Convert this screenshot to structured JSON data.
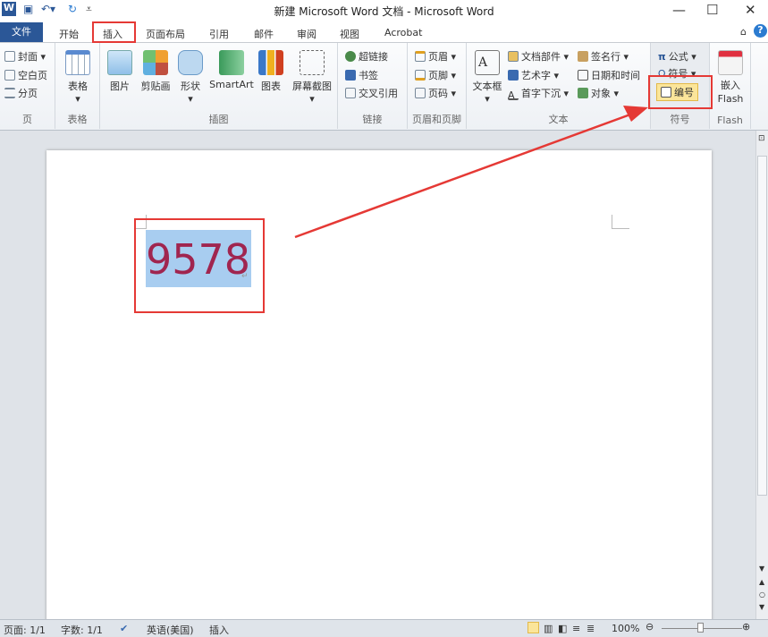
{
  "window": {
    "title": "新建 Microsoft Word 文档 - Microsoft Word"
  },
  "tabs": [
    {
      "label": "文件"
    },
    {
      "label": "开始"
    },
    {
      "label": "插入"
    },
    {
      "label": "页面布局"
    },
    {
      "label": "引用"
    },
    {
      "label": "邮件"
    },
    {
      "label": "审阅"
    },
    {
      "label": "视图"
    },
    {
      "label": "Acrobat"
    }
  ],
  "ribbon": {
    "pages": {
      "label": "页",
      "items": [
        "封面",
        "空白页",
        "分页"
      ]
    },
    "table": {
      "label": "表格",
      "button": "表格"
    },
    "illustrations": {
      "label": "插图",
      "items": [
        "图片",
        "剪贴画",
        "形状",
        "SmartArt",
        "图表",
        "屏幕截图"
      ]
    },
    "links": {
      "label": "链接",
      "items": [
        "超链接",
        "书签",
        "交叉引用"
      ]
    },
    "header_footer": {
      "label": "页眉和页脚",
      "items": [
        "页眉",
        "页脚",
        "页码"
      ]
    },
    "text": {
      "label": "文本",
      "textbox": "文本框",
      "items": [
        "文档部件",
        "艺术字",
        "首字下沉",
        "签名行",
        "日期和时间",
        "对象"
      ]
    },
    "symbols": {
      "label": "符号",
      "items": [
        "公式",
        "符号",
        "编号"
      ]
    },
    "flash": {
      "label": "Flash",
      "button_line1": "嵌入",
      "button_line2": "Flash"
    }
  },
  "document": {
    "selected_text": "9578"
  },
  "status": {
    "page": "页面: 1/1",
    "words": "字数: 1/1",
    "language": "英语(美国)",
    "mode": "插入",
    "zoom": "100%"
  },
  "colors": {
    "accent": "#2b5797",
    "annotation": "#e53935",
    "selection": "#a8cdf0",
    "text": "#a0254f"
  }
}
